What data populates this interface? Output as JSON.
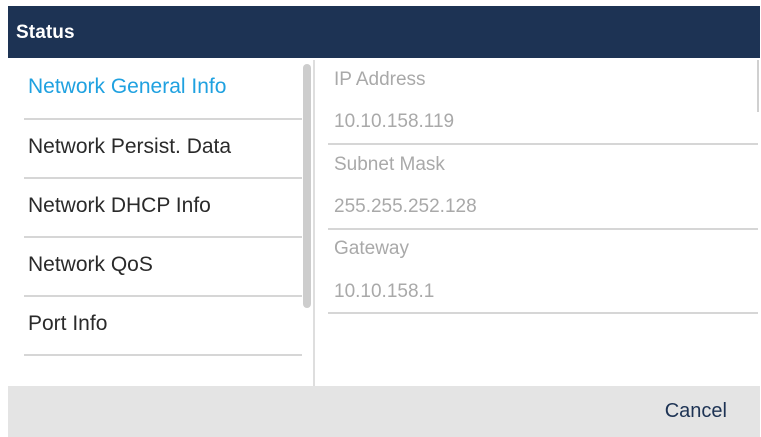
{
  "header": {
    "title": "Status"
  },
  "menu": {
    "selected_index": 0,
    "items": [
      {
        "label": "Network General Info"
      },
      {
        "label": "Network Persist. Data"
      },
      {
        "label": "Network DHCP Info"
      },
      {
        "label": "Network QoS"
      },
      {
        "label": "Port Info"
      }
    ]
  },
  "details": [
    {
      "label": "IP Address",
      "value": "10.10.158.119"
    },
    {
      "label": "Subnet Mask",
      "value": "255.255.252.128"
    },
    {
      "label": "Gateway",
      "value": "10.10.158.1"
    }
  ],
  "footer": {
    "cancel_label": "Cancel"
  },
  "colors": {
    "title_bar": "#1d3354",
    "selected_item": "#1fa1e0",
    "footer_bg": "#e4e4e4"
  }
}
